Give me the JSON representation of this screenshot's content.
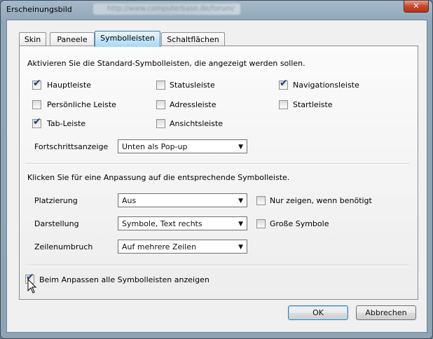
{
  "window": {
    "title": "Erscheinungsbild",
    "background_title": "http://www.computerbase.de/forum/",
    "close_icon": "close-icon",
    "close_glyph": "✕"
  },
  "tabs": [
    {
      "label": "Skin"
    },
    {
      "label": "Paneele"
    },
    {
      "label": "Symbolleisten",
      "active": true
    },
    {
      "label": "Schaltflächen"
    }
  ],
  "section1": {
    "heading": "Aktivieren Sie die Standard-Symbolleisten, die angezeigt werden sollen.",
    "checkboxes": [
      {
        "label": "Hauptleiste",
        "checked": true
      },
      {
        "label": "Statusleiste",
        "checked": false
      },
      {
        "label": "Navigationsleiste",
        "checked": true
      },
      {
        "label": "Persönliche Leiste",
        "checked": false
      },
      {
        "label": "Adressleiste",
        "checked": false
      },
      {
        "label": "Startleiste",
        "checked": false
      },
      {
        "label": "Tab-Leiste",
        "checked": true
      },
      {
        "label": "Ansichtsleiste",
        "checked": false
      }
    ],
    "progress_label": "Fortschrittsanzeige",
    "progress_value": "Unten als Pop-up"
  },
  "section2": {
    "heading": "Klicken Sie für eine Anpassung auf die entsprechende Symbolleiste.",
    "placement_label": "Platzierung",
    "placement_value": "Aus",
    "only_when_needed_label": "Nur zeigen, wenn benötigt",
    "display_label": "Darstellung",
    "display_value": "Symbole, Text rechts",
    "large_symbols_label": "Große Symbole",
    "wrap_label": "Zeilenumbruch",
    "wrap_value": "Auf mehrere Zeilen"
  },
  "show_all_label": "Beim Anpassen alle Symbolleisten anzeigen",
  "show_all_checked": true,
  "buttons": {
    "ok": "OK",
    "cancel": "Abbrechen"
  },
  "icons": {
    "check": "✔",
    "dropdown": "▼"
  }
}
